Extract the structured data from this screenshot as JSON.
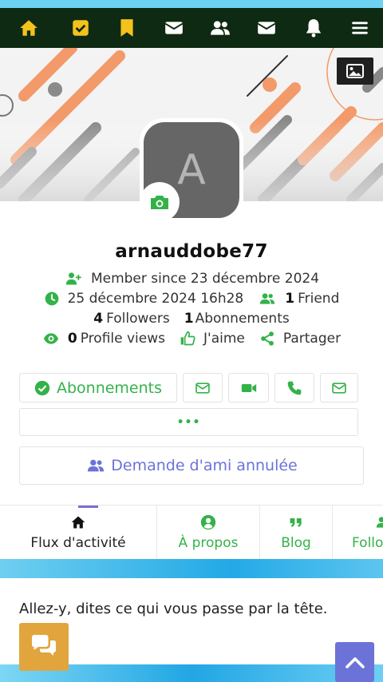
{
  "nav": {
    "items": [
      "home",
      "tasks",
      "bookmarks",
      "messages",
      "friends",
      "mail",
      "notifications",
      "menu"
    ]
  },
  "colors": {
    "accent_yellow": "#f4c21c",
    "green": "#34b24a",
    "purple": "#6b73d8",
    "nav_bg": "#0e2a12"
  },
  "profile": {
    "avatar_letter": "A",
    "username": "arnauddobe77",
    "member_since": "Member since 23 décembre 2024",
    "last_seen": "25 décembre 2024 16h28",
    "friends_count": "1",
    "friends_label": "Friend",
    "followers_count": "4",
    "followers_label": "Followers",
    "subscriptions_count": "1",
    "subscriptions_label": "Abonnements",
    "profile_views_count": "0",
    "profile_views_label": "Profile views",
    "like_label": "J'aime",
    "share_label": "Partager"
  },
  "actions": {
    "subscriptions_button": "Abonnements",
    "more_button": "•••",
    "friend_request_cancelled": "Demande d'ami annulée"
  },
  "tabs": [
    {
      "label": "Flux d'activité"
    },
    {
      "label": "À propos"
    },
    {
      "label": "Blog"
    },
    {
      "label": "Follo"
    }
  ],
  "post": {
    "placeholder": "Allez-y, dites ce qui vous passe par la tête."
  }
}
